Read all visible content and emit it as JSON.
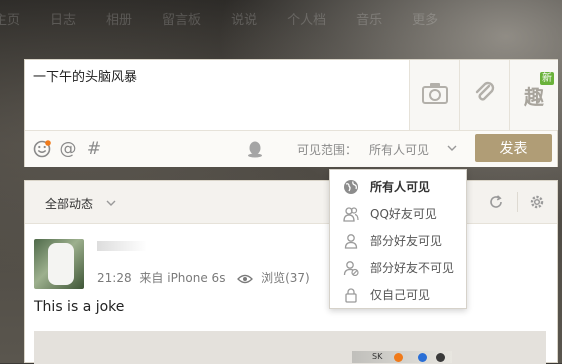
{
  "nav": {
    "items": [
      "主页",
      "日志",
      "相册",
      "留言板",
      "说说",
      "个人档",
      "音乐",
      "更多"
    ]
  },
  "composer": {
    "text": "一下午的头脑风暴",
    "new_badge": "新",
    "fun_label": "趣",
    "visibility_label": "可见范围：",
    "visibility_value": "所有人可见",
    "post_button": "发表"
  },
  "feed": {
    "filter_label": "全部动态",
    "post": {
      "time": "21:28",
      "source": "来自 iPhone 6s",
      "views": "浏览(37)",
      "text": "This is a joke"
    }
  },
  "visibility_menu": {
    "items": [
      {
        "label": "所有人可见",
        "icon": "globe-icon",
        "selected": true
      },
      {
        "label": "QQ好友可见",
        "icon": "friends-icon",
        "selected": false
      },
      {
        "label": "部分好友可见",
        "icon": "person-icon",
        "selected": false
      },
      {
        "label": "部分好友不可见",
        "icon": "person-block-icon",
        "selected": false
      },
      {
        "label": "仅自己可见",
        "icon": "lock-icon",
        "selected": false
      }
    ]
  },
  "taskbar": {
    "label": "SK"
  },
  "colors": {
    "accent": "#b09d76",
    "new_badge": "#6ab23a",
    "notification_dot": "#f07a1a"
  }
}
